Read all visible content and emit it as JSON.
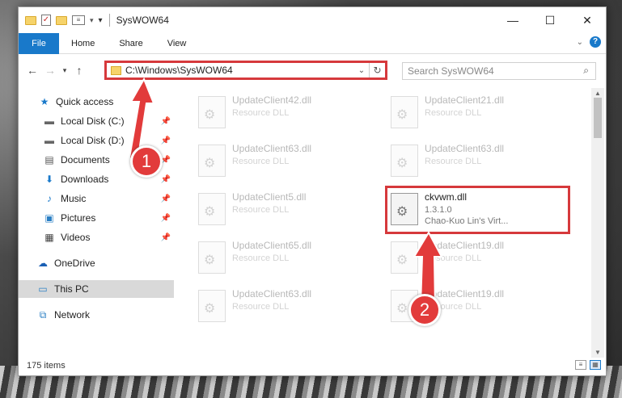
{
  "titlebar": {
    "title": "SysWOW64",
    "buttons": {
      "minimize": "—",
      "maximize": "☐",
      "close": "✕"
    }
  },
  "ribbon": {
    "tabs": [
      "File",
      "Home",
      "Share",
      "View"
    ]
  },
  "address": {
    "path": "C:\\Windows\\SysWOW64",
    "search_placeholder": "Search SysWOW64"
  },
  "nav": {
    "items": [
      {
        "label": "Quick access",
        "icon": "star-icon"
      },
      {
        "label": "Local Disk (C:)",
        "icon": "drive-icon"
      },
      {
        "label": "Local Disk (D:)",
        "icon": "drive-icon"
      },
      {
        "label": "Documents",
        "icon": "document-icon"
      },
      {
        "label": "Downloads",
        "icon": "download-icon"
      },
      {
        "label": "Music",
        "icon": "music-icon"
      },
      {
        "label": "Pictures",
        "icon": "picture-icon"
      },
      {
        "label": "Videos",
        "icon": "video-icon"
      },
      {
        "label": "OneDrive",
        "icon": "cloud-icon"
      },
      {
        "label": "This PC",
        "icon": "computer-icon"
      },
      {
        "label": "Network",
        "icon": "network-icon"
      }
    ]
  },
  "files": [
    {
      "name": "UpdateClient42.dll",
      "sub": "Resource DLL"
    },
    {
      "name": "UpdateClient21.dll",
      "sub": "Resource DLL"
    },
    {
      "name": "UpdateClient63.dll",
      "sub": "Resource DLL"
    },
    {
      "name": "UpdateClient63.dll",
      "sub": "Resource DLL"
    },
    {
      "name": "UpdateClient5.dll",
      "sub": "Resource DLL"
    },
    {
      "name": "ckvwm.dll",
      "sub": "1.3.1.0",
      "sub2": "Chao-Kuo Lin's Virt..."
    },
    {
      "name": "UpdateClient65.dll",
      "sub": "Resource DLL"
    },
    {
      "name": "UpdateClient19.dll",
      "sub": "Resource DLL"
    },
    {
      "name": "UpdateClient63.dll",
      "sub": "Resource DLL"
    },
    {
      "name": "UpdateClient19.dll",
      "sub": "Resource DLL"
    }
  ],
  "status": {
    "count": "175 items"
  },
  "markers": [
    "1",
    "2"
  ],
  "colors": {
    "accent": "#1979ca",
    "annotation": "#d6393c"
  }
}
